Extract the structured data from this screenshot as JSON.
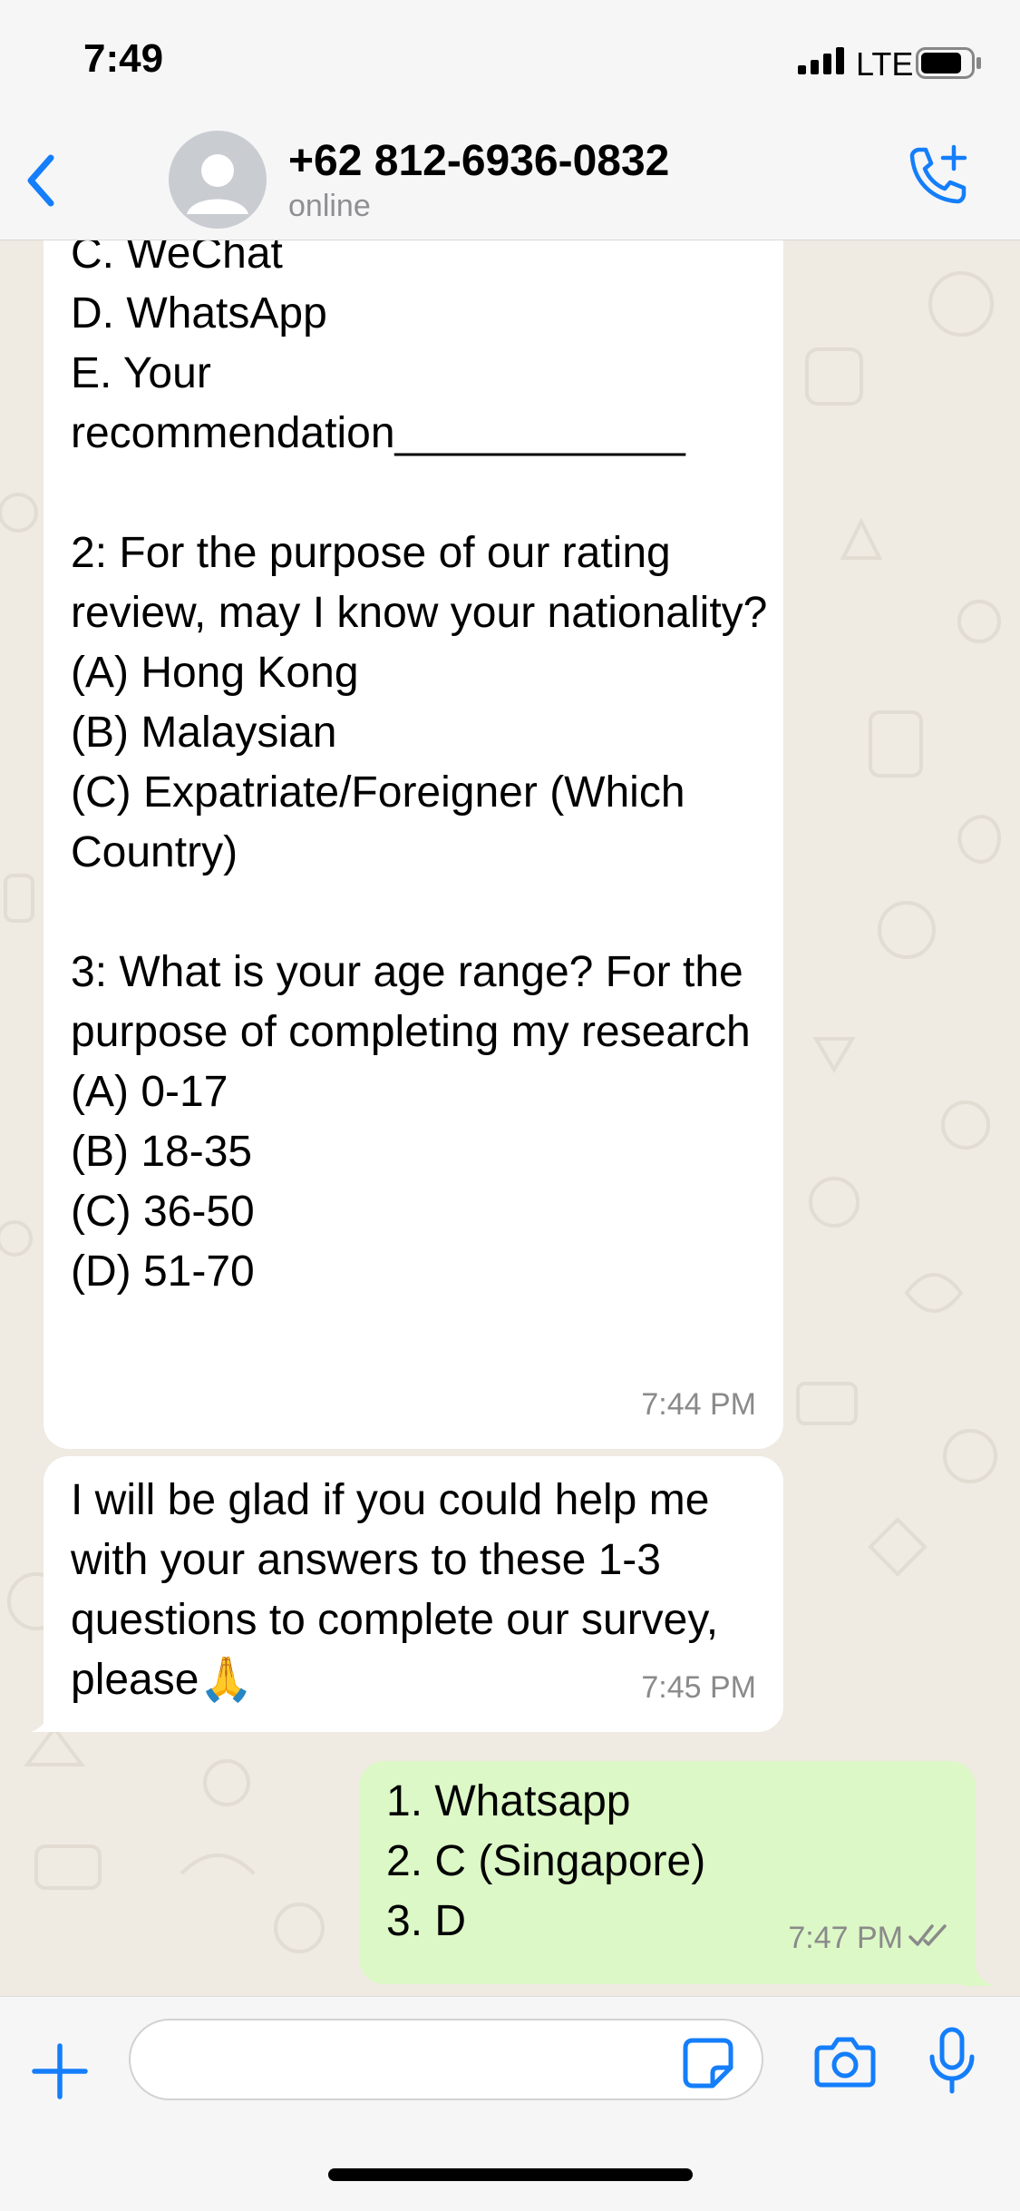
{
  "status_bar": {
    "time": "7:49",
    "network": "LTE"
  },
  "header": {
    "contact_name": "+62 812-6936-0832",
    "status": "online"
  },
  "messages": [
    {
      "direction": "incoming",
      "text": "C. WeChat\nD. WhatsApp\nE. Your\nrecommendation____________\n\n2: For the purpose of our rating review, may I know your nationality?\n(A) Hong Kong\n(B) Malaysian\n(C) Expatriate/Foreigner (Which Country)\n\n3: What is your age range? For the purpose of completing my research\n(A) 0-17\n(B) 18-35\n(C) 36-50\n(D) 51-70",
      "time": "7:44 PM"
    },
    {
      "direction": "incoming",
      "text": "I will be glad if you could help me with your answers to these 1-3 questions to complete our survey, please🙏",
      "time": "7:45 PM"
    },
    {
      "direction": "outgoing",
      "text": "1. Whatsapp\n2. C (Singapore)\n3. D",
      "time": "7:47 PM",
      "read_receipt": "double-check-icon"
    }
  ],
  "composer": {
    "value": "",
    "placeholder": ""
  },
  "colors": {
    "accent": "#147efb",
    "outgoing_bubble": "#dcf8c6",
    "incoming_bubble": "#ffffff",
    "chat_background": "#efeae2"
  }
}
